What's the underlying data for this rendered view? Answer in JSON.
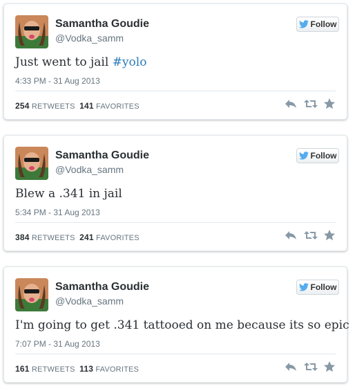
{
  "tweets": [
    {
      "name": "Samantha Goudie",
      "handle": "@Vodka_samm",
      "follow_label": "Follow",
      "text": "Just went to jail ",
      "hashtag": "#yolo",
      "timestamp": "4:33 PM - 31 Aug 2013",
      "retweets": "254",
      "retweets_label": "RETWEETS",
      "favorites": "141",
      "favorites_label": "FAVORITES"
    },
    {
      "name": "Samantha Goudie",
      "handle": "@Vodka_samm",
      "follow_label": "Follow",
      "text": "Blew a .341 in jail",
      "hashtag": "",
      "timestamp": "5:34 PM - 31 Aug 2013",
      "retweets": "384",
      "retweets_label": "RETWEETS",
      "favorites": "241",
      "favorites_label": "FAVORITES"
    },
    {
      "name": "Samantha Goudie",
      "handle": "@Vodka_samm",
      "follow_label": "Follow",
      "text": "I'm going to get .341 tattooed on me because its so epic",
      "hashtag": "",
      "timestamp": "7:07 PM - 31 Aug 2013",
      "retweets": "161",
      "retweets_label": "RETWEETS",
      "favorites": "113",
      "favorites_label": "FAVORITES"
    }
  ],
  "colors": {
    "link": "#2b7bb9",
    "bird": "#55acee",
    "icon": "#8899a6"
  },
  "icons": [
    "twitter-bird-icon",
    "reply-icon",
    "retweet-icon",
    "favorite-icon"
  ]
}
